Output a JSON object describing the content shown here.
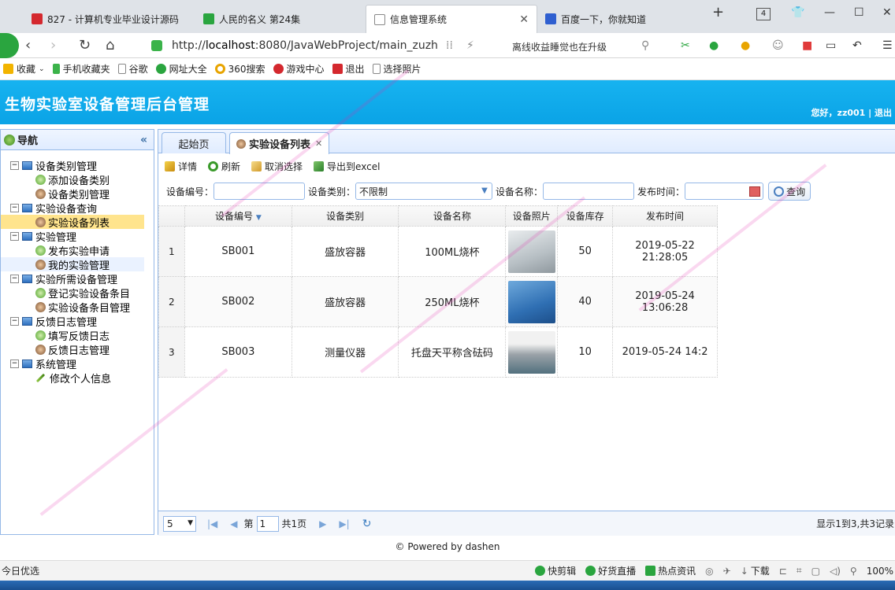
{
  "browser": {
    "tabs": [
      {
        "label": "827 - 计算机专业毕业设计源码"
      },
      {
        "label": "人民的名义 第24集"
      },
      {
        "label": "信息管理系统"
      },
      {
        "label": "百度一下，你就知道"
      }
    ],
    "tab_count": "4",
    "url_prefix": "http://",
    "url_host": "localhost",
    "url_rest": ":8080/JavaWebProject/main_zuzh",
    "address_hint": "离线收益睡觉也在升级",
    "bookmarks": [
      "收藏",
      "手机收藏夹",
      "谷歌",
      "网址大全",
      "360搜索",
      "游戏中心",
      "退出",
      "选择照片"
    ]
  },
  "app": {
    "title": "生物实验室设备管理后台管理",
    "welcome": "您好，zz001 | 退出"
  },
  "sidebar": {
    "title": "导航",
    "collapse_glyph": "«",
    "groups": [
      {
        "label": "设备类别管理",
        "items": [
          "添加设备类别",
          "设备类别管理"
        ]
      },
      {
        "label": "实验设备查询",
        "items": [
          "实验设备列表"
        ]
      },
      {
        "label": "实验管理",
        "items": [
          "发布实验申请",
          "我的实验管理"
        ]
      },
      {
        "label": "实验所需设备管理",
        "items": [
          "登记实验设备条目",
          "实验设备条目管理"
        ]
      },
      {
        "label": "反馈日志管理",
        "items": [
          "填写反馈日志",
          "反馈日志管理"
        ]
      },
      {
        "label": "系统管理",
        "items": [
          "修改个人信息"
        ]
      }
    ]
  },
  "main": {
    "tabs": [
      {
        "label": "起始页"
      },
      {
        "label": "实验设备列表"
      }
    ],
    "toolbar": [
      "详情",
      "刷新",
      "取消选择",
      "导出到excel"
    ],
    "filters": {
      "code_label": "设备编号：",
      "type_label": "设备类别：",
      "type_value": "不限制",
      "name_label": "设备名称：",
      "time_label": "发布时间：",
      "query_label": "查询"
    },
    "columns": [
      "设备编号",
      "设备类别",
      "设备名称",
      "设备照片",
      "设备库存",
      "发布时间"
    ],
    "rows": [
      {
        "n": "1",
        "code": "SB001",
        "type": "盛放容器",
        "name": "100ML烧杯",
        "stock": "50",
        "time": "2019-05-22 21:28:05"
      },
      {
        "n": "2",
        "code": "SB002",
        "type": "盛放容器",
        "name": "250ML烧杯",
        "stock": "40",
        "time": "2019-05-24 13:06:28"
      },
      {
        "n": "3",
        "code": "SB003",
        "type": "测量仪器",
        "name": "托盘天平称含砝码",
        "stock": "10",
        "time": "2019-05-24 14:2"
      }
    ],
    "pager": {
      "page_size": "5",
      "page_prefix": "第",
      "page": "1",
      "page_total": "共1页",
      "info": "显示1到3,共3记录"
    }
  },
  "footer": "© Powered by dashen",
  "statusbar": {
    "left": "今日优选",
    "items": [
      "快剪辑",
      "好货直播",
      "热点资讯",
      "下载"
    ],
    "zoom": "100%"
  },
  "colors": {
    "header": "#0aa3e6",
    "border": "#95b8e7",
    "selected": "#ffe48d"
  }
}
